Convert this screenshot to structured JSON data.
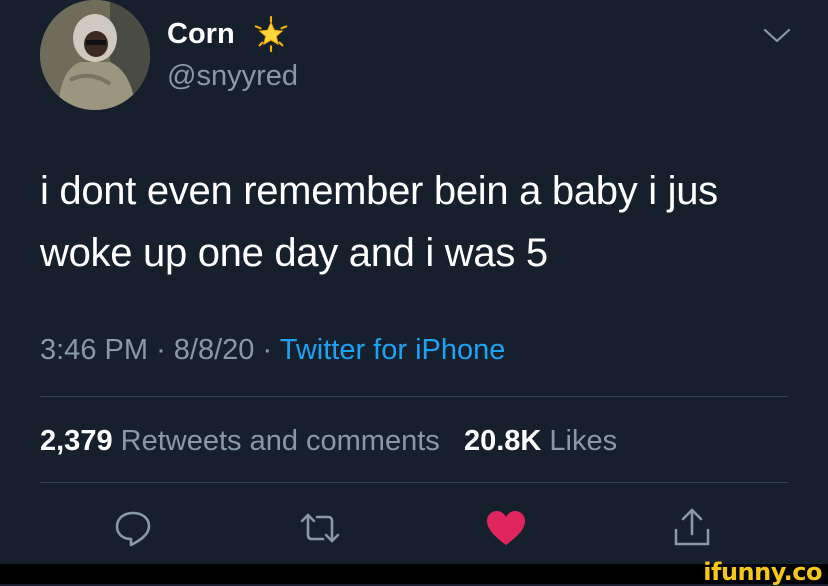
{
  "tweet": {
    "author": {
      "display_name": "Corn",
      "name_emoji": "glowing-star-icon",
      "handle": "@snyyred"
    },
    "text_lines": [
      "i dont even remember bein a baby i jus",
      "woke up one day and i was 5"
    ],
    "time": "3:46 PM",
    "separator": "·",
    "date": "8/8/20",
    "source": "Twitter for iPhone",
    "stats": {
      "retweets_count": "2,379",
      "retweets_label": "Retweets and comments",
      "likes_count": "20.8K",
      "likes_label": "Likes"
    },
    "liked": true
  },
  "actions": [
    "reply-icon",
    "retweet-icon",
    "heart-icon",
    "share-icon"
  ],
  "colors": {
    "background": "#16202c",
    "secondary_text": "#8899a6",
    "link": "#1da1f2",
    "like": "#e0245e",
    "divider": "#38444d"
  },
  "watermark": "ifunny.co"
}
